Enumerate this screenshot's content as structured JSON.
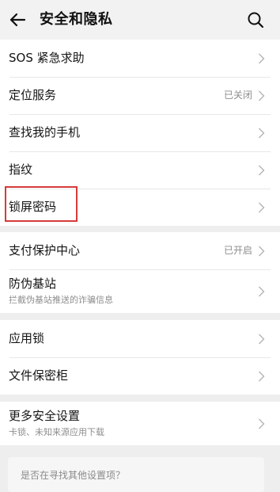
{
  "header": {
    "back_icon": "arrow-left-icon",
    "title": "安全和隐私",
    "search_icon": "search-icon"
  },
  "groups": [
    {
      "items": [
        {
          "label": "SOS 紧急求助"
        },
        {
          "label": "定位服务",
          "status": "已关闭"
        },
        {
          "label": "查找我的手机"
        },
        {
          "label": "指纹"
        },
        {
          "label": "锁屏密码",
          "highlighted": true
        }
      ]
    },
    {
      "items": [
        {
          "label": "支付保护中心",
          "status": "已开启"
        },
        {
          "label": "防伪基站",
          "subtitle": "拦截伪基站推送的诈骗信息"
        }
      ]
    },
    {
      "items": [
        {
          "label": "应用锁"
        },
        {
          "label": "文件保密柜"
        }
      ]
    },
    {
      "items": [
        {
          "label": "更多安全设置",
          "subtitle": "卡锁、未知来源应用下载"
        }
      ]
    }
  ],
  "suggestion": {
    "text": "是否在寻找其他设置项？"
  },
  "colors": {
    "highlight": "#d63b3b",
    "secondary_text": "#8d8d8d",
    "background": "#eeeeee"
  }
}
